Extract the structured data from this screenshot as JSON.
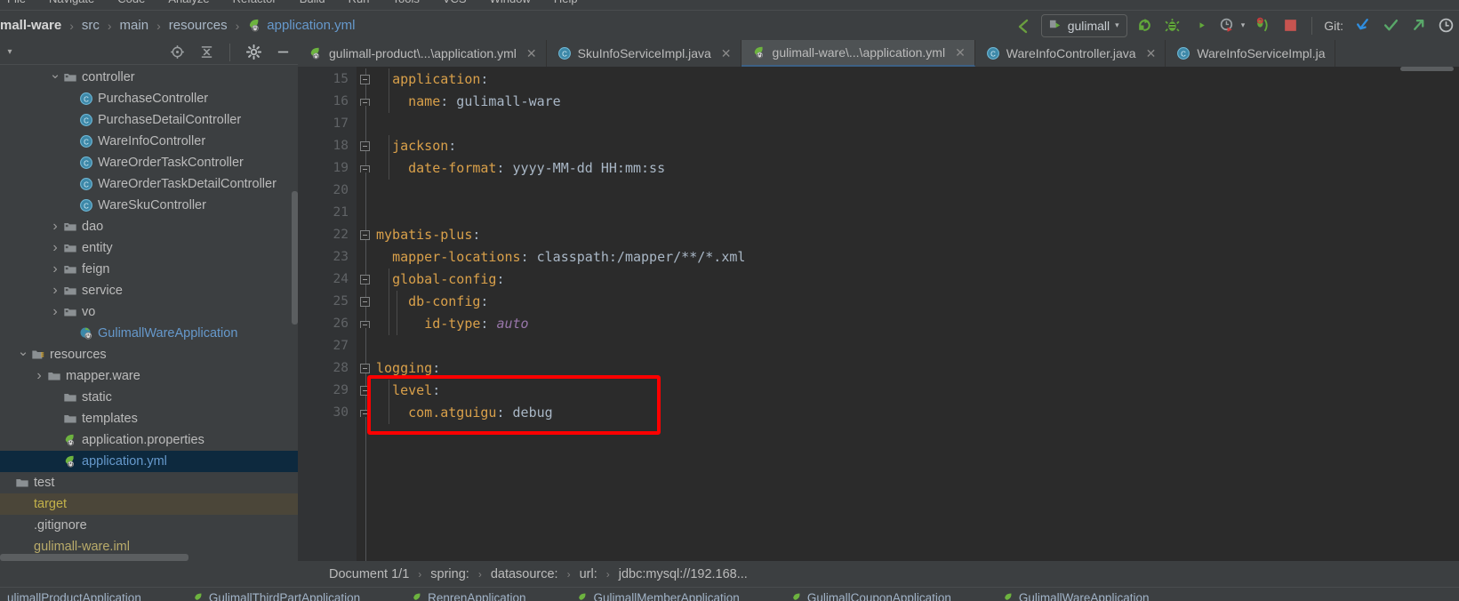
{
  "window": {
    "menu_items": [
      "File",
      "Navigate",
      "Code",
      "Analyze",
      "Refactor",
      "Build",
      "Run",
      "Tools",
      "VCS",
      "Window",
      "Help"
    ]
  },
  "navbar": {
    "breadcrumbs": [
      {
        "label": "mall-ware",
        "style": "bold"
      },
      {
        "label": "src",
        "style": "plain"
      },
      {
        "label": "main",
        "style": "plain"
      },
      {
        "label": "resources",
        "style": "plain"
      },
      {
        "label": "application.yml",
        "style": "file",
        "icon": "spring-yaml-icon"
      }
    ],
    "separator": "›",
    "run_configuration": "gulimall",
    "run_config_dropdown": "▾",
    "git_label": "Git:",
    "icons": [
      "back-arrow-icon",
      "run-icon",
      "debug-icon",
      "run-with-coverage-icon",
      "profiler-icon",
      "attach-debugger-icon",
      "stop-icon",
      "update-project-icon",
      "commit-icon",
      "push-icon",
      "history-icon"
    ]
  },
  "sidebar": {
    "collapse_caret": "▾",
    "tools": [
      "locate-icon",
      "collapse-all-icon",
      "settings-gear-icon",
      "hide-icon"
    ],
    "tree": [
      {
        "label": "controller",
        "type": "folder",
        "indent": 3,
        "arrow": "down",
        "icon": "package-folder-icon"
      },
      {
        "label": "PurchaseController",
        "type": "class",
        "indent": 4,
        "arrow": "none",
        "icon": "java-class-icon"
      },
      {
        "label": "PurchaseDetailController",
        "type": "class",
        "indent": 4,
        "arrow": "none",
        "icon": "java-class-icon"
      },
      {
        "label": "WareInfoController",
        "type": "class",
        "indent": 4,
        "arrow": "none",
        "icon": "java-class-icon"
      },
      {
        "label": "WareOrderTaskController",
        "type": "class",
        "indent": 4,
        "arrow": "none",
        "icon": "java-class-icon"
      },
      {
        "label": "WareOrderTaskDetailController",
        "type": "class",
        "indent": 4,
        "arrow": "none",
        "icon": "java-class-icon"
      },
      {
        "label": "WareSkuController",
        "type": "class",
        "indent": 4,
        "arrow": "none",
        "icon": "java-class-icon"
      },
      {
        "label": "dao",
        "type": "folder",
        "indent": 3,
        "arrow": "right",
        "icon": "package-folder-icon"
      },
      {
        "label": "entity",
        "type": "folder",
        "indent": 3,
        "arrow": "right",
        "icon": "package-folder-icon"
      },
      {
        "label": "feign",
        "type": "folder",
        "indent": 3,
        "arrow": "right",
        "icon": "package-folder-icon"
      },
      {
        "label": "service",
        "type": "folder",
        "indent": 3,
        "arrow": "right",
        "icon": "package-folder-icon"
      },
      {
        "label": "vo",
        "type": "folder",
        "indent": 3,
        "arrow": "right",
        "icon": "package-folder-icon"
      },
      {
        "label": "GulimallWareApplication",
        "type": "springapp",
        "indent": 4,
        "arrow": "none",
        "icon": "spring-boot-class-icon"
      },
      {
        "label": "resources",
        "type": "resource-root",
        "indent": 1,
        "arrow": "down",
        "icon": "resources-folder-icon"
      },
      {
        "label": "mapper.ware",
        "type": "plainfolder",
        "indent": 2,
        "arrow": "right",
        "icon": "folder-icon"
      },
      {
        "label": "static",
        "type": "plainfolder",
        "indent": 3,
        "arrow": "none",
        "icon": "folder-icon"
      },
      {
        "label": "templates",
        "type": "plainfolder",
        "indent": 3,
        "arrow": "none",
        "icon": "folder-icon"
      },
      {
        "label": "application.properties",
        "type": "springfile",
        "indent": 3,
        "arrow": "none",
        "icon": "spring-yaml-icon"
      },
      {
        "label": "application.yml",
        "type": "springfile",
        "indent": 3,
        "arrow": "none",
        "icon": "spring-yaml-icon",
        "selected": true
      },
      {
        "label": "test",
        "type": "plainfolder",
        "indent": 0,
        "arrow": "none",
        "icon": "folder-icon"
      },
      {
        "label": "target",
        "type": "excluded",
        "indent": 0,
        "arrow": "none",
        "icon": "none",
        "highlight": true
      },
      {
        "label": ".gitignore",
        "type": "file",
        "indent": 0,
        "arrow": "none",
        "icon": "none"
      },
      {
        "label": "gulimall-ware.iml",
        "type": "file-yellow",
        "indent": 0,
        "arrow": "none",
        "icon": "none"
      }
    ]
  },
  "editor": {
    "tabs": [
      {
        "label": "gulimall-product\\...\\application.yml",
        "icon": "spring-yaml-icon",
        "active": false,
        "close": "✕"
      },
      {
        "label": "SkuInfoServiceImpl.java",
        "icon": "java-class-icon",
        "active": false,
        "close": "✕"
      },
      {
        "label": "gulimall-ware\\...\\application.yml",
        "icon": "spring-yaml-icon",
        "active": true,
        "close": "✕"
      },
      {
        "label": "WareInfoController.java",
        "icon": "java-class-icon",
        "active": false,
        "close": "✕"
      },
      {
        "label": "WareInfoServiceImpl.ja",
        "icon": "java-class-icon",
        "active": false,
        "close": ""
      }
    ],
    "first_line_number": 15,
    "lines": [
      {
        "n": 15,
        "indent": 1,
        "key": "application",
        "value": "",
        "fold": "open"
      },
      {
        "n": 16,
        "indent": 2,
        "key": "name",
        "value": "gulimall-ware",
        "fold": "end"
      },
      {
        "n": 17,
        "indent": 0,
        "key": "",
        "value": "",
        "fold": "none"
      },
      {
        "n": 18,
        "indent": 1,
        "key": "jackson",
        "value": "",
        "fold": "open"
      },
      {
        "n": 19,
        "indent": 2,
        "key": "date-format",
        "value": "yyyy-MM-dd HH:mm:ss",
        "fold": "end"
      },
      {
        "n": 20,
        "indent": 0,
        "key": "",
        "value": "",
        "fold": "none"
      },
      {
        "n": 21,
        "indent": 0,
        "key": "",
        "value": "",
        "fold": "none"
      },
      {
        "n": 22,
        "indent": 0,
        "key": "mybatis-plus",
        "value": "",
        "fold": "open"
      },
      {
        "n": 23,
        "indent": 1,
        "key": "mapper-locations",
        "value": "classpath:/mapper/**/*.xml",
        "fold": "none"
      },
      {
        "n": 24,
        "indent": 1,
        "key": "global-config",
        "value": "",
        "fold": "open"
      },
      {
        "n": 25,
        "indent": 2,
        "key": "db-config",
        "value": "",
        "fold": "open"
      },
      {
        "n": 26,
        "indent": 3,
        "key": "id-type",
        "value": "auto",
        "value_style": "italic",
        "fold": "end"
      },
      {
        "n": 27,
        "indent": 0,
        "key": "",
        "value": "",
        "fold": "none"
      },
      {
        "n": 28,
        "indent": 0,
        "key": "logging",
        "value": "",
        "fold": "open"
      },
      {
        "n": 29,
        "indent": 1,
        "key": "level",
        "value": "",
        "fold": "open"
      },
      {
        "n": 30,
        "indent": 2,
        "key": "com.atguigu",
        "value": "debug",
        "fold": "end"
      }
    ],
    "annotation": {
      "type": "red-rectangle",
      "color": "#fe0000"
    }
  },
  "breadcrumb_bar": {
    "items": [
      "Document 1/1",
      "spring:",
      "datasource:",
      "url:",
      "jdbc:mysql://192.168..."
    ],
    "separator": "›"
  },
  "run_strip": {
    "items": [
      "ulimallProductApplication",
      "GulimallThirdPartApplication",
      "RenrenApplication",
      "GulimallMemberApplication",
      "GulimallCouponApplication",
      "GulimallWareApplication"
    ]
  },
  "colors": {
    "chrome": "#3c3f41",
    "editor_bg": "#2b2b2b",
    "gutter_bg": "#313335",
    "selection": "#0d293e",
    "accent_key": "#d9a04a",
    "accent_link": "#6699cc",
    "annotation_red": "#fe0000",
    "excluded_folder": "#c3b24a"
  }
}
